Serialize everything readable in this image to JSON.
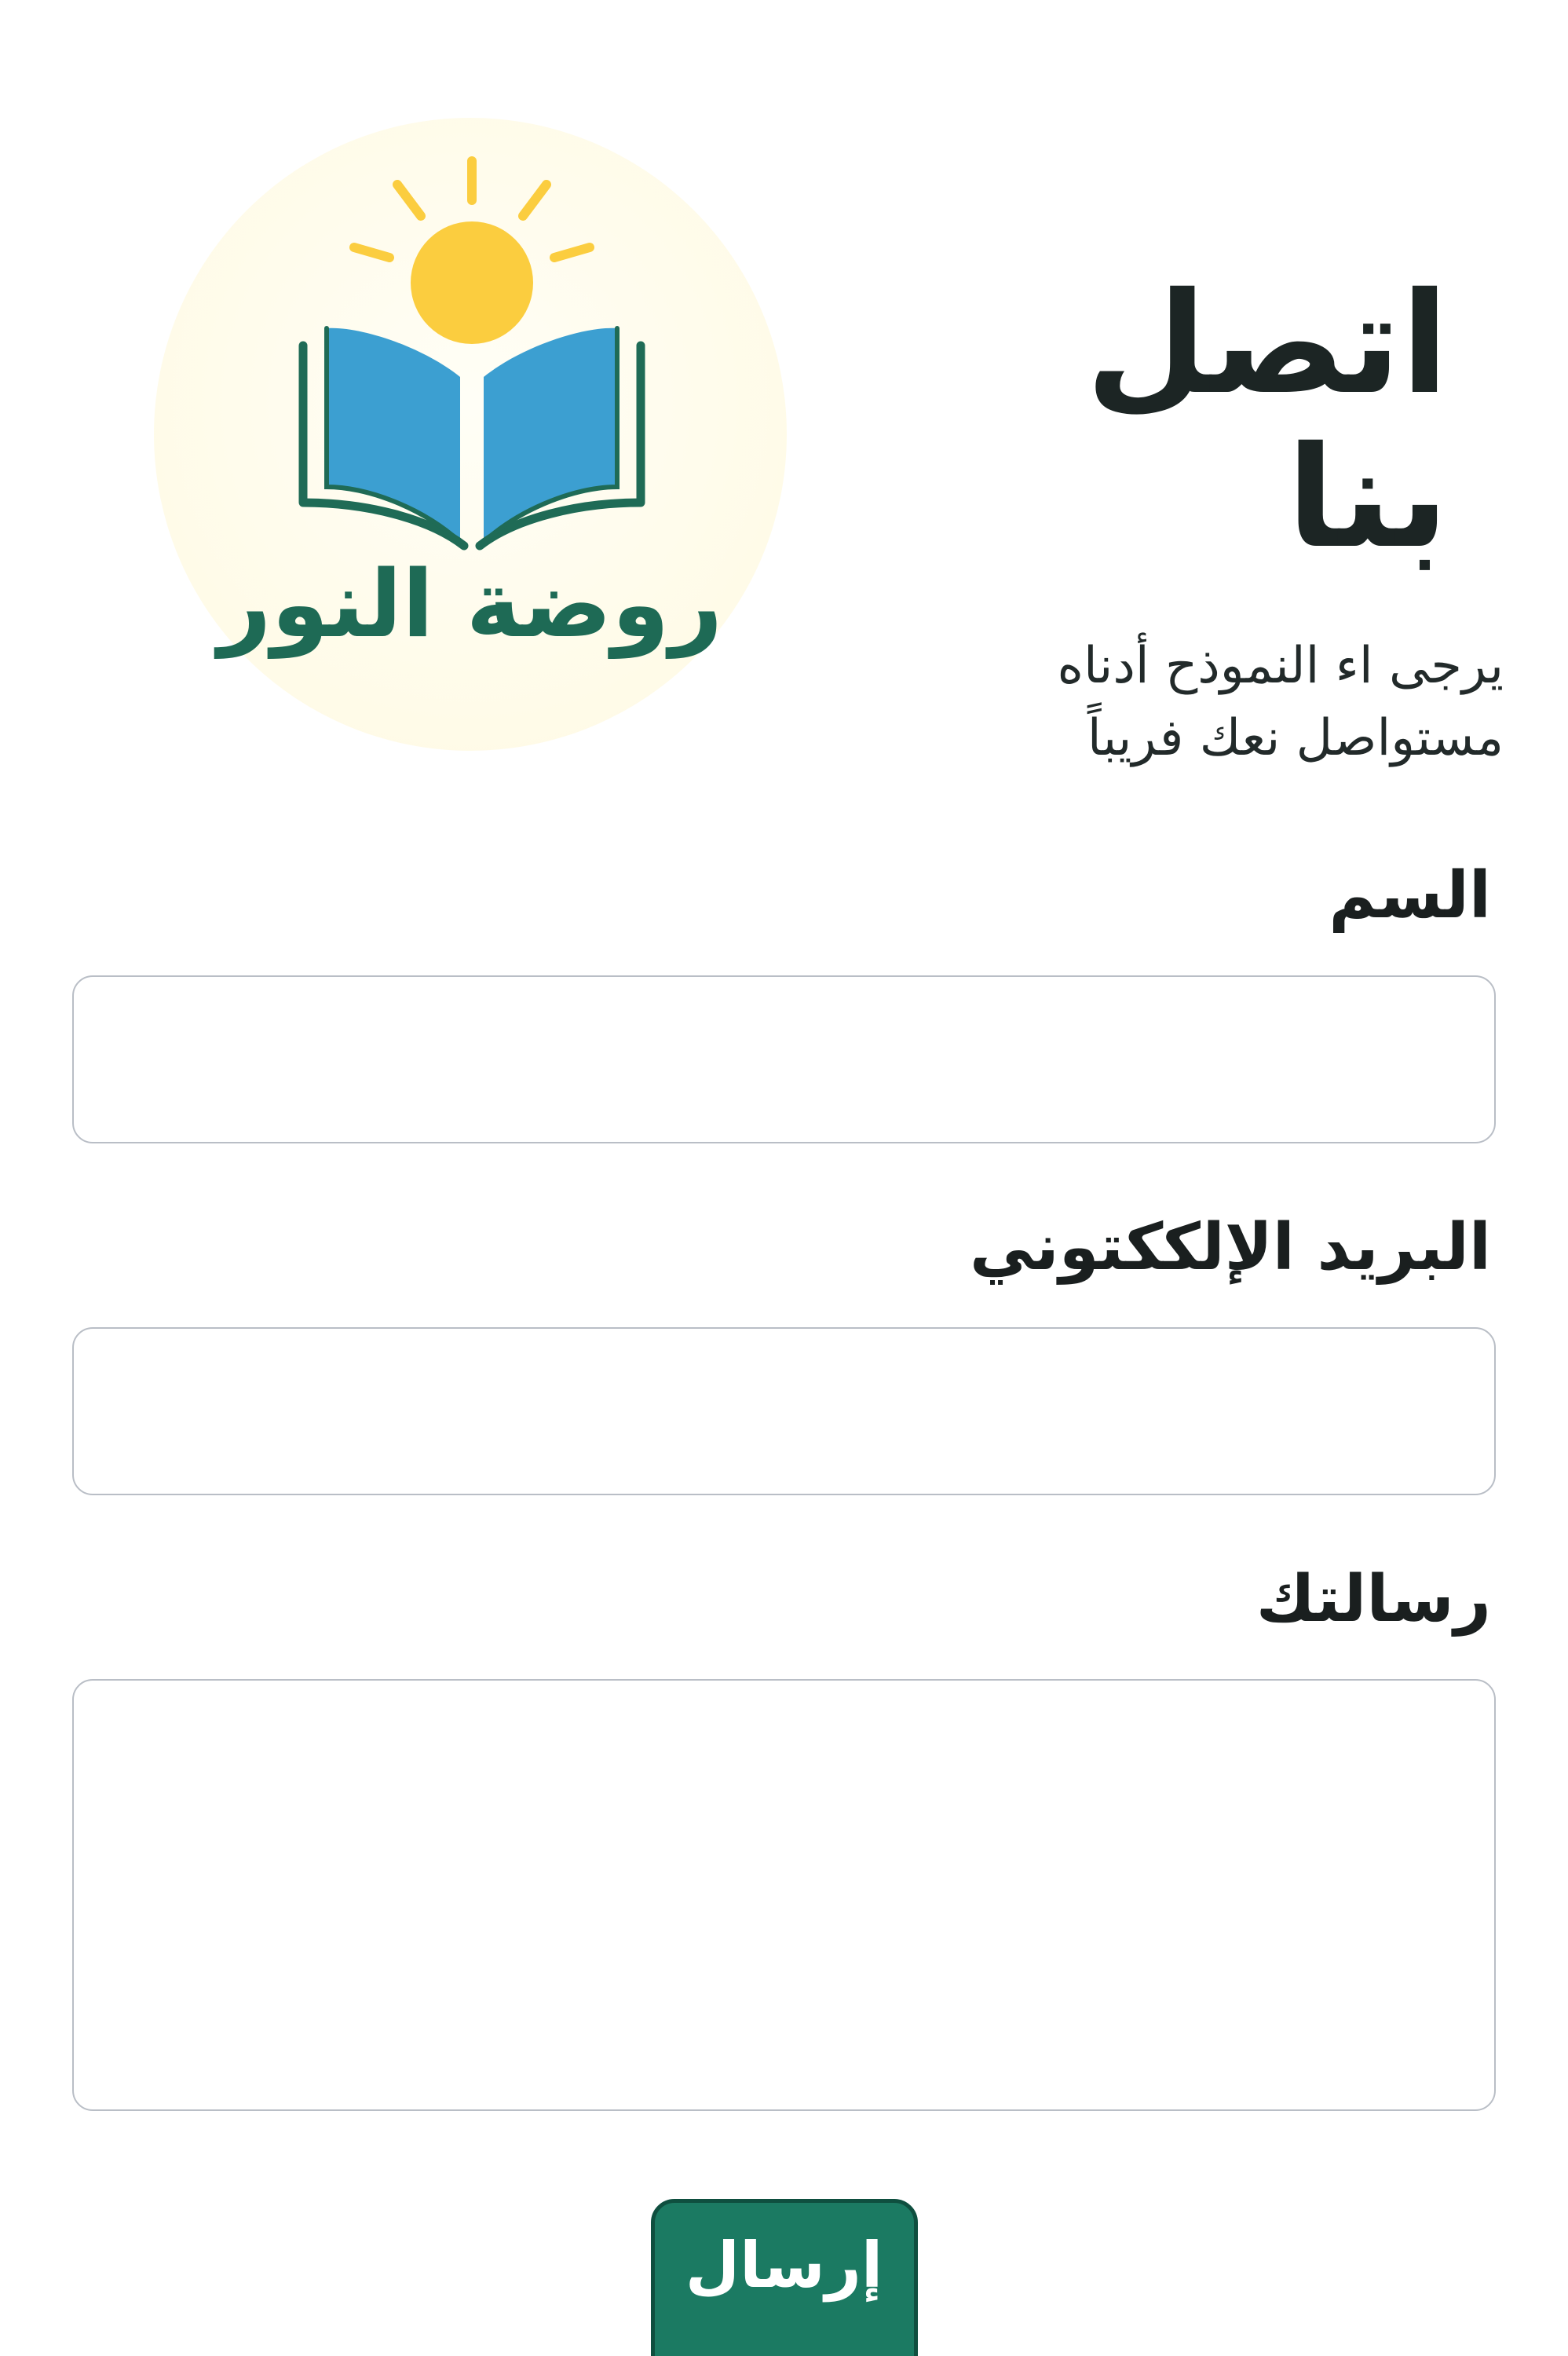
{
  "logo": {
    "brand_name": "روضة النور",
    "icon": "open-book-with-sun-icon",
    "colors": {
      "sun": "#fbcd3f",
      "book": "#3c9fd1",
      "book_outline": "#1f6b56",
      "text": "#1e6a55",
      "circle": "#fffbe8"
    }
  },
  "header": {
    "title": "اتصل بنا",
    "subtitle_line1": "يرجى اء النموذح أدناه",
    "subtitle_line2": "مستواصل نعك فريباً"
  },
  "form": {
    "name_label": "السم",
    "name_value": "",
    "email_label": "البريد الإلككتوني",
    "email_value": "",
    "message_label": "رسالتك",
    "message_value": "",
    "submit_label": "إرسال"
  },
  "colors": {
    "accent": "#1b7a62",
    "input_border": "#b9bec6",
    "text": "#1e2424"
  }
}
